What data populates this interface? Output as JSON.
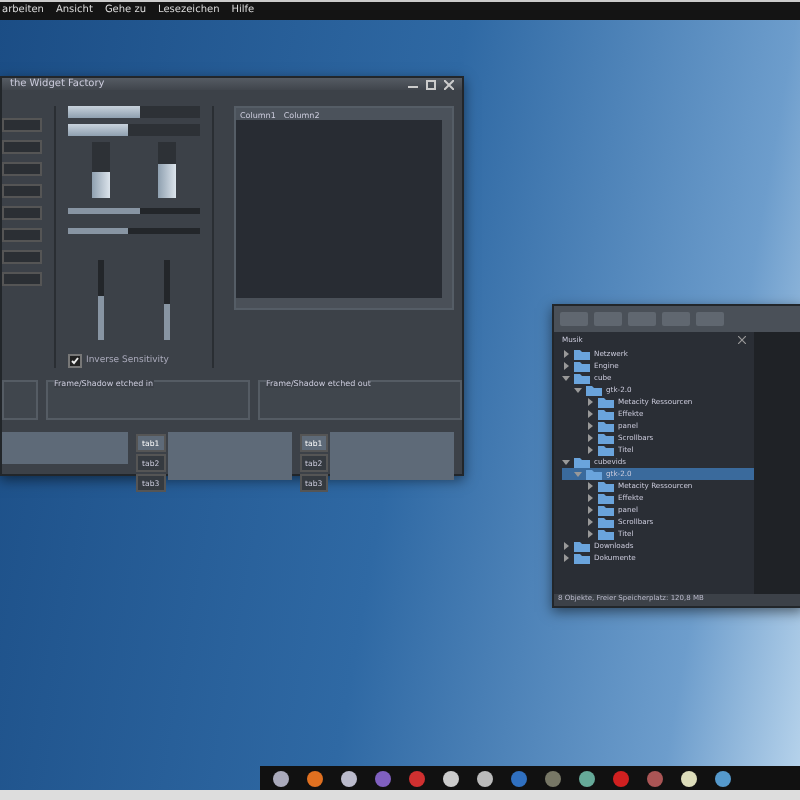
{
  "menu_bar": {
    "items": [
      "arbeiten",
      "Ansicht",
      "Gehe zu",
      "Lesezeichen",
      "Hilfe"
    ]
  },
  "widget_window": {
    "title": "the Widget Factory",
    "progress": [
      {
        "level": 0.55
      },
      {
        "level": 0.45
      }
    ],
    "vertical_progress": [
      {
        "level": 0.45
      },
      {
        "level": 0.6
      }
    ],
    "hscales": [
      {
        "level": 0.55
      },
      {
        "level": 0.45
      }
    ],
    "vscales": [
      {
        "level": 0.55
      },
      {
        "level": 0.45
      }
    ],
    "checkbox": {
      "label": "Inverse Sensitivity",
      "checked": true
    },
    "list": {
      "columns": [
        "Column1",
        "Column2"
      ]
    },
    "frames": [
      "Frame/Shadow etched in",
      "Frame/Shadow etched out"
    ],
    "notebooks": [
      {
        "tabs": [
          {
            "label": "tab1",
            "selected": true
          },
          {
            "label": "tab2",
            "selected": false
          },
          {
            "label": "tab3",
            "selected": false
          }
        ]
      },
      {
        "tabs": [
          {
            "label": "tab1",
            "selected": true
          },
          {
            "label": "tab2",
            "selected": false
          },
          {
            "label": "tab3",
            "selected": false
          }
        ]
      }
    ]
  },
  "file_window": {
    "sidebar_label": "Musik",
    "tree": [
      {
        "label": "Netzwerk",
        "expanded": false
      },
      {
        "label": "Engine",
        "expanded": false
      },
      {
        "label": "cube",
        "expanded": true,
        "selected": false,
        "children": [
          {
            "label": "gtk-2.0",
            "expanded": true,
            "selected": false,
            "children": [
              {
                "label": "Metacity Ressourcen",
                "expanded": false
              },
              {
                "label": "Effekte",
                "expanded": false
              },
              {
                "label": "panel",
                "expanded": false
              },
              {
                "label": "Scrollbars",
                "expanded": false
              },
              {
                "label": "Titel",
                "expanded": false
              }
            ]
          }
        ]
      },
      {
        "label": "cubevids",
        "expanded": true,
        "selected": false,
        "children": [
          {
            "label": "gtk-2.0",
            "expanded": true,
            "selected": true,
            "children": [
              {
                "label": "Metacity Ressourcen",
                "expanded": false
              },
              {
                "label": "Effekte",
                "expanded": false
              },
              {
                "label": "panel",
                "expanded": false
              },
              {
                "label": "Scrollbars",
                "expanded": false
              },
              {
                "label": "Titel",
                "expanded": false
              }
            ]
          }
        ]
      },
      {
        "label": "Downloads",
        "expanded": false
      },
      {
        "label": "Dokumente",
        "expanded": false
      }
    ],
    "status": "8 Objekte, Freier Speicherplatz: 120,8 MB"
  }
}
